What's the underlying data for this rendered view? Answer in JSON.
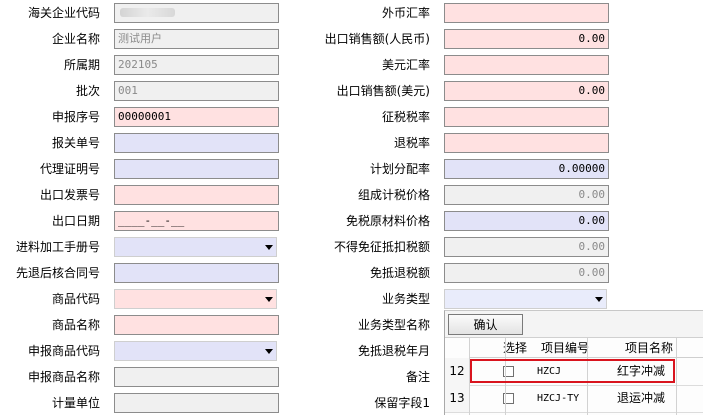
{
  "left_fields": [
    {
      "label": "海关企业代码",
      "value": "",
      "style": "gray",
      "blurred": true
    },
    {
      "label": "企业名称",
      "value": "测试用户",
      "style": "gray"
    },
    {
      "label": "所属期",
      "value": "202105",
      "style": "gray"
    },
    {
      "label": "批次",
      "value": "001",
      "style": "gray"
    },
    {
      "label": "申报序号",
      "value": "00000001",
      "style": "pink"
    },
    {
      "label": "报关单号",
      "value": "",
      "style": "blue"
    },
    {
      "label": "代理证明号",
      "value": "",
      "style": "blue"
    },
    {
      "label": "出口发票号",
      "value": "",
      "style": "pink"
    },
    {
      "label": "出口日期",
      "value": "____-__-__",
      "style": "pink"
    },
    {
      "label": "进料加工手册号",
      "value": "",
      "style": "dropdown-blue"
    },
    {
      "label": "先退后核合同号",
      "value": "",
      "style": "blue"
    },
    {
      "label": "商品代码",
      "value": "",
      "style": "dropdown-pink"
    },
    {
      "label": "商品名称",
      "value": "",
      "style": "pink"
    },
    {
      "label": "申报商品代码",
      "value": "",
      "style": "dropdown-blue"
    },
    {
      "label": "申报商品名称",
      "value": "",
      "style": "gray"
    },
    {
      "label": "计量单位",
      "value": "",
      "style": "gray"
    }
  ],
  "right_fields": [
    {
      "label": "外币汇率",
      "value": "",
      "style": "pink"
    },
    {
      "label": "出口销售额(人民币)",
      "value": "0.00",
      "style": "pink"
    },
    {
      "label": "美元汇率",
      "value": "",
      "style": "pink"
    },
    {
      "label": "出口销售额(美元)",
      "value": "0.00",
      "style": "pink"
    },
    {
      "label": "征税税率",
      "value": "",
      "style": "pink"
    },
    {
      "label": "退税率",
      "value": "",
      "style": "pink"
    },
    {
      "label": "计划分配率",
      "value": "0.00000",
      "style": "blue"
    },
    {
      "label": "组成计税价格",
      "value": "0.00",
      "style": "gray"
    },
    {
      "label": "免税原材料价格",
      "value": "0.00",
      "style": "blue"
    },
    {
      "label": "不得免征抵扣税额",
      "value": "0.00",
      "style": "gray"
    },
    {
      "label": "免抵退税额",
      "value": "0.00",
      "style": "gray"
    },
    {
      "label": "业务类型",
      "value": "",
      "style": "dropdown-pale"
    },
    {
      "label": "业务类型名称",
      "value": "",
      "style": "none"
    },
    {
      "label": "免抵退税年月",
      "value": "",
      "style": "none"
    },
    {
      "label": "备注",
      "value": "",
      "style": "none"
    },
    {
      "label": "保留字段1",
      "value": "",
      "style": "none"
    }
  ],
  "popup": {
    "confirm_label": "确认",
    "columns": [
      "选择",
      "项目编号",
      "项目名称"
    ],
    "rows": [
      {
        "num": "12",
        "code": "HZCJ",
        "name": "红字冲减",
        "checked": false
      },
      {
        "num": "13",
        "code": "HZCJ-TY",
        "name": "退运冲减",
        "checked": false
      }
    ]
  }
}
